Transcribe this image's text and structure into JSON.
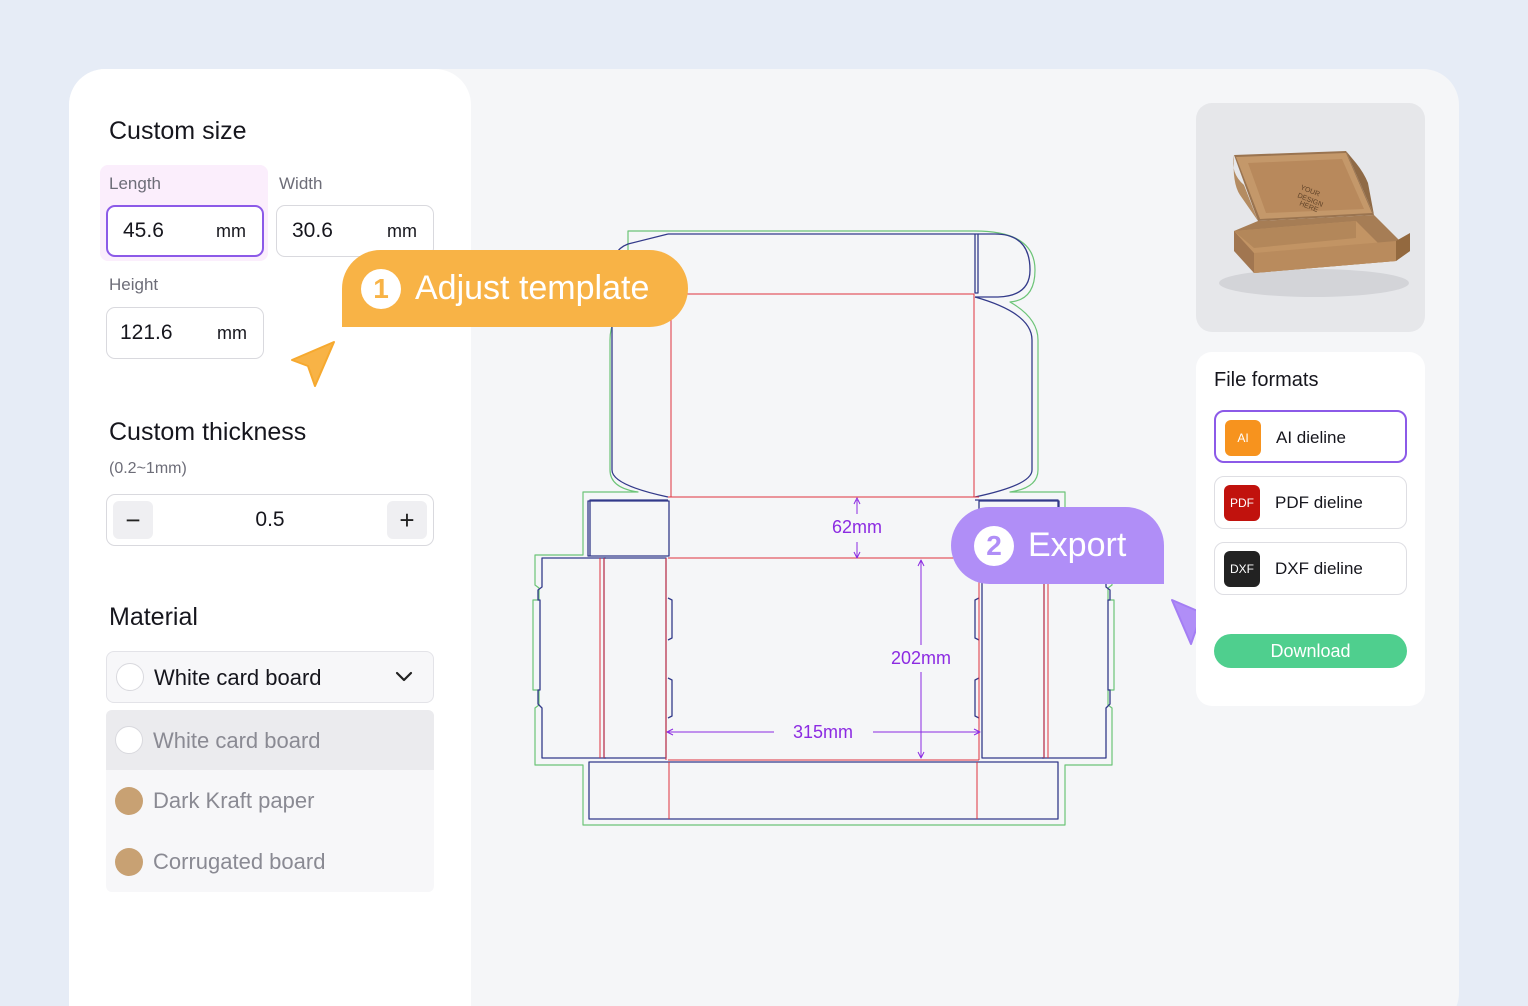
{
  "custom_size": {
    "title": "Custom size",
    "length": {
      "label": "Length",
      "value": "45.6",
      "unit": "mm"
    },
    "width": {
      "label": "Width",
      "value": "30.6",
      "unit": "mm"
    },
    "height": {
      "label": "Height",
      "value": "121.6",
      "unit": "mm"
    }
  },
  "custom_thickness": {
    "title": "Custom thickness",
    "range": "(0.2~1mm)",
    "value": "0.5",
    "minus": "−",
    "plus": "+"
  },
  "material": {
    "title": "Material",
    "selected": "White card board",
    "options": [
      {
        "label": "White card board",
        "swatch": "#ffffff"
      },
      {
        "label": "Dark Kraft paper",
        "swatch": "#c8a173"
      },
      {
        "label": "Corrugated board",
        "swatch": "#c8a173"
      }
    ]
  },
  "callouts": {
    "adjust": {
      "num": "1",
      "label": "Adjust template"
    },
    "export": {
      "num": "2",
      "label": "Export"
    }
  },
  "dieline": {
    "dims": {
      "a": "62mm",
      "b": "202mm",
      "c": "315mm"
    },
    "colors": {
      "cut": "#333a8a",
      "crease": "#e0323e",
      "bleed": "#6cc477",
      "dimension": "#8c2be2"
    }
  },
  "preview": {
    "box_print": [
      "YOUR",
      "DESIGN",
      "HERE"
    ]
  },
  "file_formats": {
    "title": "File formats",
    "items": [
      {
        "icon": "AI",
        "label": "AI dieline",
        "color": "#f7931e"
      },
      {
        "icon": "PDF",
        "label": "PDF dieline",
        "color": "#c1120d"
      },
      {
        "icon": "DXF",
        "label": "DXF dieline",
        "color": "#222222"
      }
    ],
    "download": "Download"
  }
}
